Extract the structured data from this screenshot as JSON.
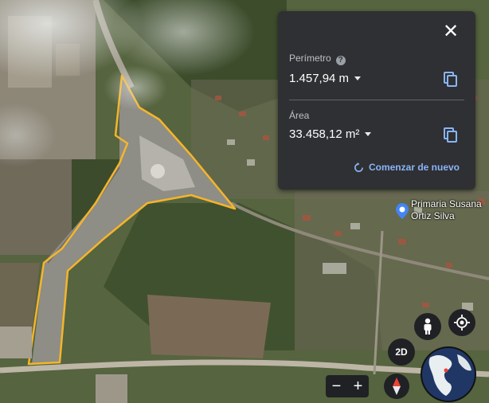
{
  "measure_panel": {
    "perimeter_label": "Perímetro",
    "perimeter_value": "1.457,94 m",
    "area_label": "Área",
    "area_value": "33.458,12 m²",
    "restart_label": "Comenzar de nuevo"
  },
  "map": {
    "poi_label_line1": "Primaria Susana",
    "poi_label_line2": "Ortiz Silva",
    "polygon_color": "#f5b52a"
  },
  "controls": {
    "view_mode_label": "2D",
    "zoom_out": "−",
    "zoom_in": "+"
  },
  "colors": {
    "panel_bg": "#2f3033",
    "accent": "#8ab4f8"
  }
}
